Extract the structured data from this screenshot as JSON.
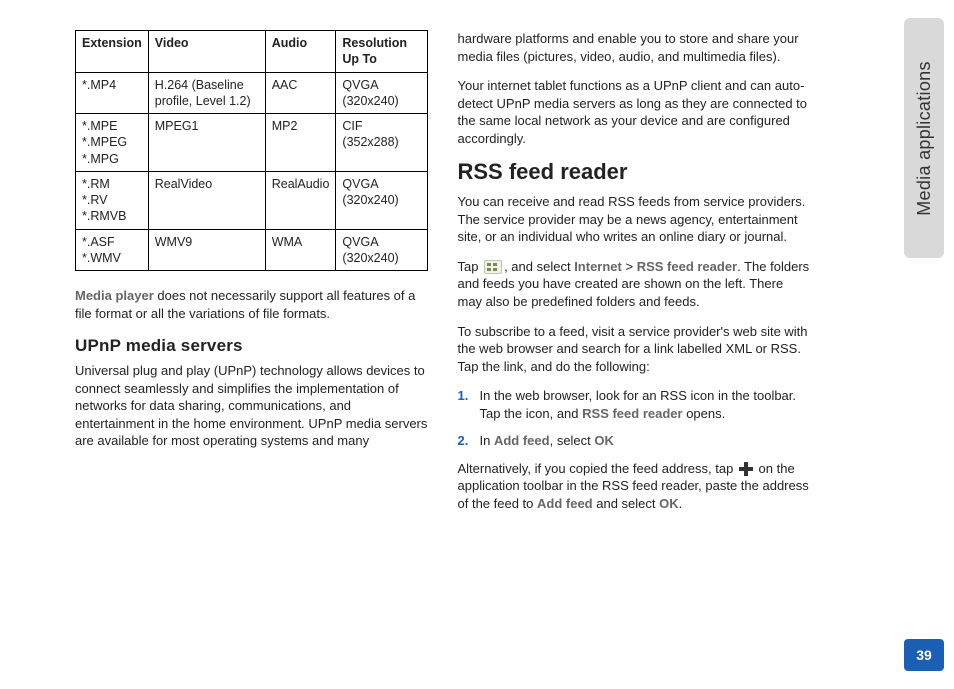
{
  "sideTab": "Media applications",
  "pageNumber": "39",
  "table": {
    "headers": [
      "Extension",
      "Video",
      "Audio",
      "Resolution Up To"
    ],
    "rows": [
      [
        "*.MP4",
        "H.264 (Baseline profile, Level 1.2)",
        "AAC",
        "QVGA (320x240)"
      ],
      [
        "*.MPE\n*.MPEG\n*.MPG",
        "MPEG1",
        "MP2",
        "CIF (352x288)"
      ],
      [
        "*.RM\n*.RV\n*.RMVB",
        "RealVideo",
        "RealAudio",
        "QVGA (320x240)"
      ],
      [
        "*.ASF\n*.WMV",
        "WMV9",
        "WMA",
        "QVGA (320x240)"
      ]
    ]
  },
  "left": {
    "noteTerm": "Media player",
    "noteRest": " does not necessarily support all features of a file format or all the variations of file formats.",
    "upnpHeading": "UPnP media servers",
    "upnpPara": "Universal plug and play (UPnP) technology allows devices to connect seamlessly and simplifies the implementation of networks for data sharing, communications, and entertainment in the home environment. UPnP media servers are available for most operating systems and many"
  },
  "right": {
    "contPara1": "hardware platforms and enable you to store and share your media files (pictures, video, audio, and multimedia files).",
    "contPara2": "Your internet tablet functions as a UPnP client and can auto-detect UPnP media servers as long as they are connected to the same local network as your device and are configured accordingly.",
    "rssHeading": "RSS feed reader",
    "rssPara1": "You can receive and read RSS feeds from service providers. The service provider may be a news agency, entertainment site, or an individual who writes an online diary or journal.",
    "tapWord": "Tap ",
    "tapMid": ", and select ",
    "internetRef": "Internet",
    "gt": " > ",
    "rssRef": "RSS feed reader",
    "tapRest": ". The folders and feeds you have created are shown on the left. There may also be predefined folders and feeds.",
    "subscribePara": "To subscribe to a feed, visit a service provider's web site with the web browser and search for a link labelled XML or RSS. Tap the link, and do the following:",
    "step1a": "In the web browser, look for an RSS icon in the toolbar. Tap the icon, and ",
    "step1Ref": "RSS feed reader",
    "step1b": " opens.",
    "step2a": "In ",
    "step2Ref1": "Add feed",
    "step2b": ", select ",
    "step2Ref2": "OK",
    "altA": "Alternatively, if you copied the feed address, tap ",
    "altB": " on the application toolbar in the RSS feed reader, paste the address of the feed to ",
    "altRef1": "Add feed",
    "altC": " and select ",
    "altRef2": "OK",
    "altD": "."
  }
}
